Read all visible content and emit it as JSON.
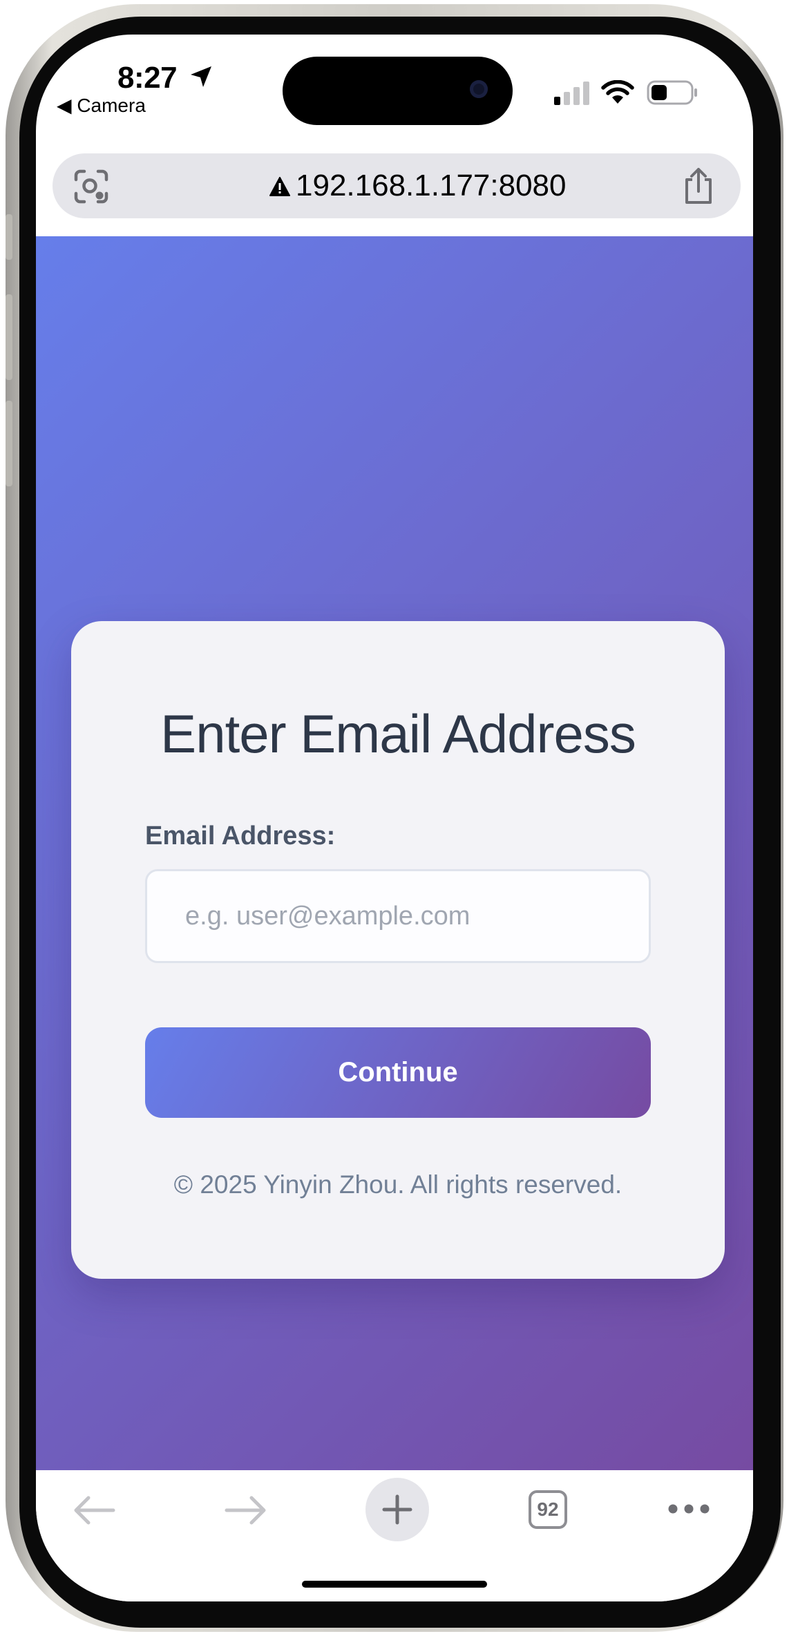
{
  "status_bar": {
    "time": "8:27",
    "back_app": "◀ Camera"
  },
  "browser": {
    "url": "192.168.1.177:8080",
    "tab_count": "92"
  },
  "login_card": {
    "title": "Enter Email Address",
    "email_label": "Email Address:",
    "email_placeholder": "e.g. user@example.com",
    "email_value": "",
    "continue_label": "Continue",
    "copyright": "© 2025 Yinyin Zhou. All rights reserved."
  },
  "colors": {
    "gradient_start": "#667eea",
    "gradient_end": "#764ba2",
    "title_text": "#2d3748",
    "muted_text": "#718096"
  },
  "icons": {
    "status": [
      "location-arrow-icon",
      "cellular-signal-icon",
      "wifi-icon",
      "battery-icon"
    ],
    "urlbar": [
      "visual-lookup-icon",
      "insecure-warning-icon",
      "share-icon"
    ],
    "toolbar": [
      "back-arrow-icon",
      "forward-arrow-icon",
      "plus-icon",
      "tabs-icon",
      "more-icon"
    ]
  }
}
